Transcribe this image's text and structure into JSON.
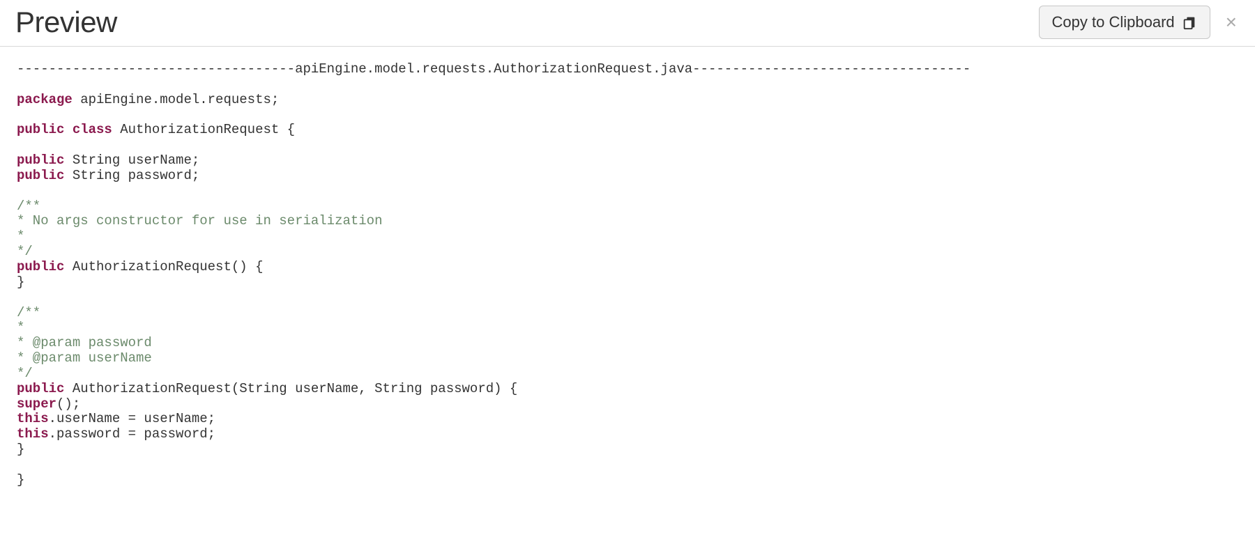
{
  "header": {
    "title": "Preview",
    "copy_label": "Copy to Clipboard",
    "close_label": "×"
  },
  "code": {
    "separator": "-----------------------------------apiEngine.model.requests.AuthorizationRequest.java-----------------------------------",
    "kw_package": "package",
    "pkg_rest": " apiEngine.model.requests;",
    "kw_public1": "public",
    "kw_class": "class",
    "class_rest": " AuthorizationRequest {",
    "kw_public2": "public",
    "field1_rest": " String userName;",
    "kw_public3": "public",
    "field2_rest": " String password;",
    "comment1_l1": "/**",
    "comment1_l2": "* No args constructor for use in serialization",
    "comment1_l3": "*",
    "comment1_l4": "*/",
    "kw_public4": "public",
    "ctor1_rest": " AuthorizationRequest() {",
    "ctor1_close": "}",
    "comment2_l1": "/**",
    "comment2_l2": "*",
    "comment2_l3": "* @param password",
    "comment2_l4": "* @param userName",
    "comment2_l5": "*/",
    "kw_public5": "public",
    "ctor2_rest": " AuthorizationRequest(String userName, String password) {",
    "kw_super": "super",
    "super_rest": "();",
    "kw_this1": "this",
    "this1_rest": ".userName = userName;",
    "kw_this2": "this",
    "this2_rest": ".password = password;",
    "ctor2_close": "}",
    "class_close": "}"
  }
}
